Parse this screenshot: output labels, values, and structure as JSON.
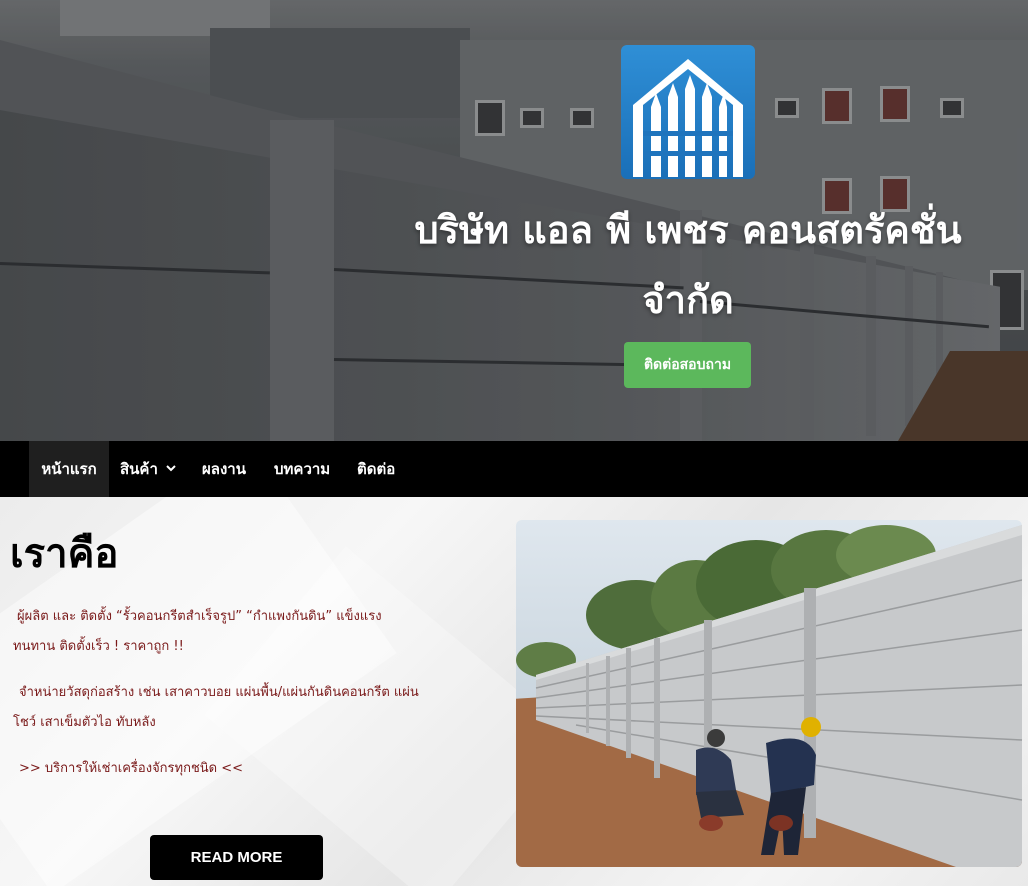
{
  "hero": {
    "logo_icon": "fence-house-icon",
    "title_line1": "บริษัท แอล พี เพชร คอนสตรัคชั่น",
    "title_line2": "จำกัด",
    "cta_label": "ติดต่อสอบถาม",
    "cta_color": "#5cb85c"
  },
  "nav": {
    "items": [
      {
        "label": "หน้าแรก",
        "active": true
      },
      {
        "label": "สินค้า",
        "has_dropdown": true,
        "icon": "chevron-down-icon"
      },
      {
        "label": "ผลงาน"
      },
      {
        "label": "บทความ"
      },
      {
        "label": "ติดต่อ"
      }
    ]
  },
  "about": {
    "title": "เราคือ",
    "para1_line1": "ผู้ผลิต และ ติดตั้ง “รั้วคอนกรีตสำเร็จรูป”   “กำแพงกันดิน”    แข็งแรง",
    "para1_line2": "ทนทาน  ติดตั้งเร็ว ! ราคาถูก !!",
    "para2_line1": "จำหน่ายวัสดุก่อสร้าง เช่น เสาคาวบอย แผ่นพื้น/แผ่นกันดินคอนกรีต แผ่น",
    "para2_line2": "โชว์ เสาเข็มตัวไอ ทับหลัง",
    "para3": ">> บริการให้เช่าเครื่องจักรทุกชนิด <<",
    "read_more_label": "READ MORE",
    "text_color": "#7a1a1a"
  }
}
